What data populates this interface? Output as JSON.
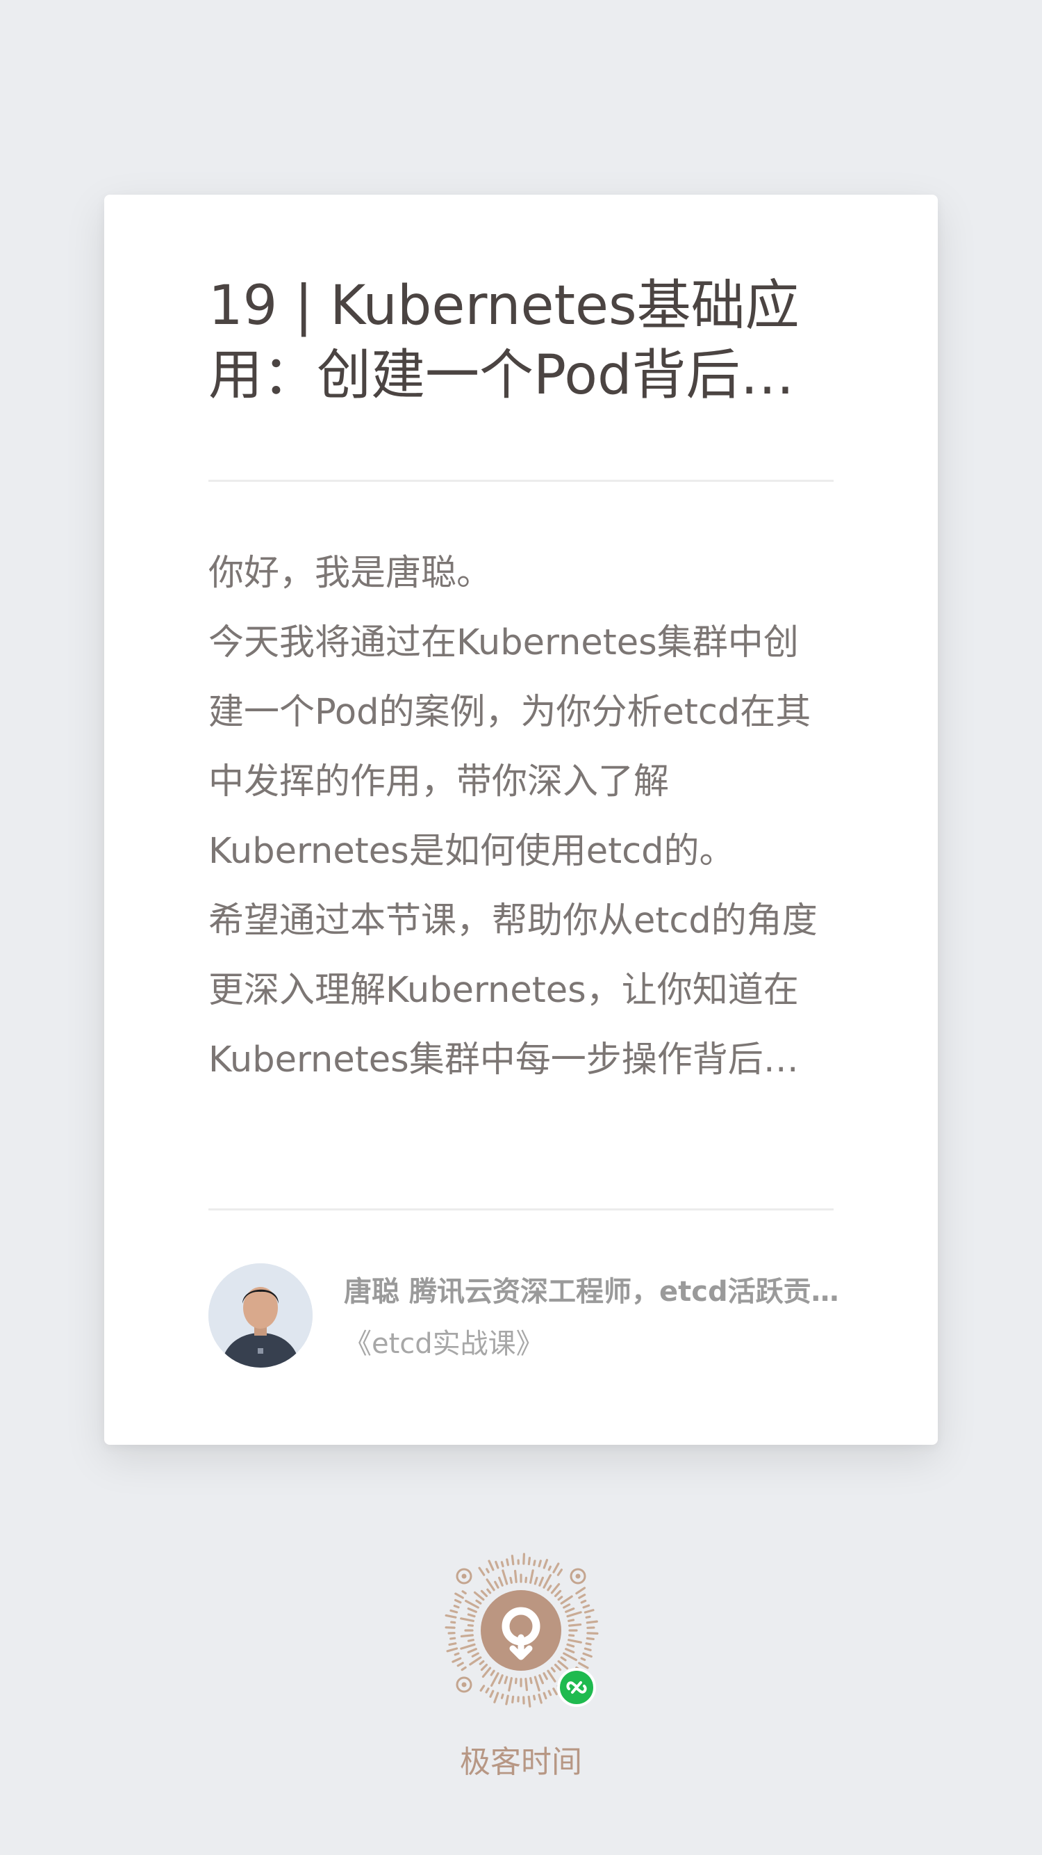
{
  "article": {
    "title": "19 | Kubernetes基础应用：创建一个Pod背后etcd发生了什么？",
    "summary": "你好，我是唐聪。\n今天我将通过在Kubernetes集群中创建一个Pod的案例，为你分析etcd在其中发挥的作用，带你深入了解Kubernetes是如何使用etcd的。\n希望通过本节课，帮助你从etcd的角度更深入理解Kubernetes，让你知道在Kubernetes集群中每一步操作背后etcd都发生了什么。"
  },
  "author": {
    "name": "唐聪",
    "bio": "腾讯云资深工程师，etcd活跃贡献者",
    "course": "《etcd实战课》"
  },
  "footer": {
    "brand": "极客时间",
    "qr_icon": "mini-program-code-icon",
    "badge_icon": "wechat-link-icon"
  },
  "colors": {
    "background": "#ebedf0",
    "card": "#ffffff",
    "brand": "#b79784",
    "badge": "#1fba4f"
  }
}
